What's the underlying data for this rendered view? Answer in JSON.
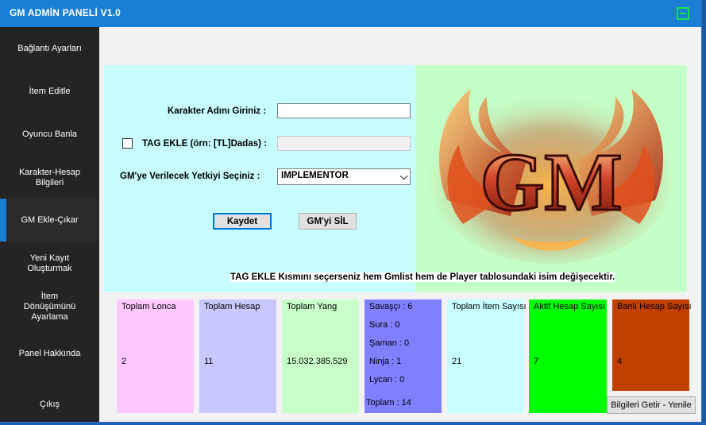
{
  "window": {
    "title": "GM ADMİN PANELİ  V1.0"
  },
  "sidebar": {
    "items": [
      {
        "label": "Bağlantı Ayarları"
      },
      {
        "label": "İtem Editle"
      },
      {
        "label": "Oyuncu Banla"
      },
      {
        "label": "Karakter-Hesap Bilgileri"
      },
      {
        "label": "GM Ekle-Çıkar"
      },
      {
        "label": "Yeni Kayıt Oluşturmak"
      },
      {
        "label": "İtem Dönüşümünü Ayarlama"
      },
      {
        "label": "Panel Hakkında"
      },
      {
        "label": "Çıkış"
      }
    ],
    "active_index": 4
  },
  "form": {
    "character_label": "Karakter Adını Giriniz :",
    "character_value": "",
    "tag_label": "TAG EKLE (örn: [TL]Dadas) :",
    "tag_checked": false,
    "tag_value": "",
    "authority_label": "GM'ye Verilecek Yetkiyi Seçiniz :",
    "authority_selected": "IMPLEMENTOR",
    "save_button": "Kaydet",
    "delete_button": "GM'yi SİL",
    "info_text": "TAG EKLE Kısmını seçerseniz hem Gmlist hem de Player tablosundaki isim değişecektir."
  },
  "logo": {
    "text": "GM"
  },
  "stats": {
    "lonca": {
      "title": "Toplam Lonca",
      "value": "2",
      "color": "#ffc8ff"
    },
    "hesap": {
      "title": "Toplam Hesap",
      "value": "11",
      "color": "#c8c8ff"
    },
    "yang": {
      "title": "Toplam Yang",
      "value": "15.032.385.529",
      "color": "#c8ffc8"
    },
    "classes": {
      "color": "#8080ff",
      "savasci": "Savaşçı : 6",
      "sura": "Sura :  0",
      "saman": "Şaman :  0",
      "ninja": "Ninja : 1",
      "lycan": "Lycan : 0",
      "toplam": "Toplam :  14"
    },
    "item": {
      "title": "Toplam İtem Sayısı",
      "value": "21",
      "color": "#c8ffff"
    },
    "aktif": {
      "title": "Aktif Hesap Sayısı",
      "value": "7",
      "color": "#00ff00"
    },
    "banli": {
      "title": "Banlı Hesap Sayısı",
      "value": "4",
      "color": "#c04000"
    }
  },
  "refresh_button": "Bilgileri Getir - Yenile"
}
